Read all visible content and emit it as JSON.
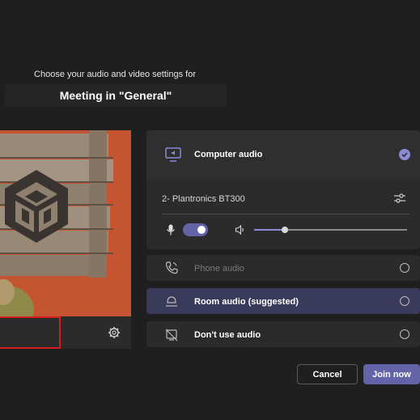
{
  "header": {
    "subtitle": "Choose your audio and video settings for",
    "meeting_title": "Meeting in \"General\""
  },
  "audio": {
    "computer_audio_label": "Computer audio",
    "device_name": "2- Plantronics BT300",
    "mic_toggle_on": true,
    "volume_level": 0.2,
    "options": [
      {
        "label": "Phone audio",
        "selected": false,
        "disabled": true
      },
      {
        "label": "Room audio (suggested)",
        "selected": false,
        "highlighted": true
      },
      {
        "label": "Don't use audio",
        "selected": false
      }
    ]
  },
  "actions": {
    "cancel_label": "Cancel",
    "join_label": "Join now"
  },
  "colors": {
    "accent": "#6264a7",
    "background": "#1f1f1f",
    "highlight_box": "#d11f1f"
  }
}
